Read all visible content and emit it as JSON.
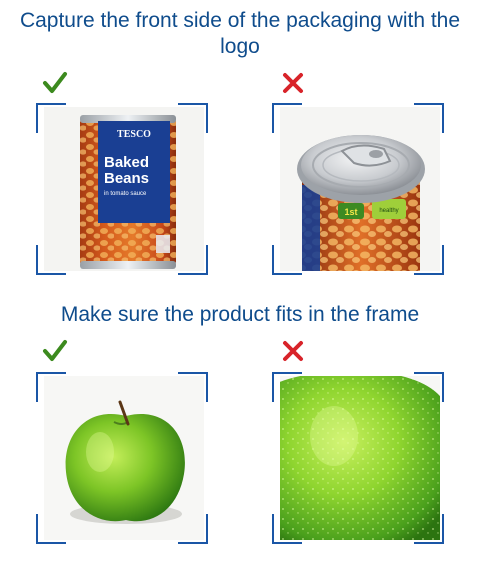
{
  "sections": [
    {
      "title": "Capture the front side of the packaging with the logo",
      "examples": [
        {
          "status": "correct",
          "icon": "check-icon",
          "color": "#3c8a1e",
          "subject": "can-front",
          "label_brand": "TESCO",
          "label_line1": "Baked",
          "label_line2": "Beans",
          "label_line3": "in tomato sauce"
        },
        {
          "status": "incorrect",
          "icon": "cross-icon",
          "color": "#d8232a",
          "subject": "can-top",
          "badge1": "1st",
          "badge2": "healthy"
        }
      ]
    },
    {
      "title": "Make sure the product fits in the frame",
      "examples": [
        {
          "status": "correct",
          "icon": "check-icon",
          "color": "#3c8a1e",
          "subject": "apple-fit"
        },
        {
          "status": "incorrect",
          "icon": "cross-icon",
          "color": "#d8232a",
          "subject": "apple-crop"
        }
      ]
    }
  ],
  "colors": {
    "heading": "#0f4c8c",
    "frame": "#1a56a6"
  }
}
